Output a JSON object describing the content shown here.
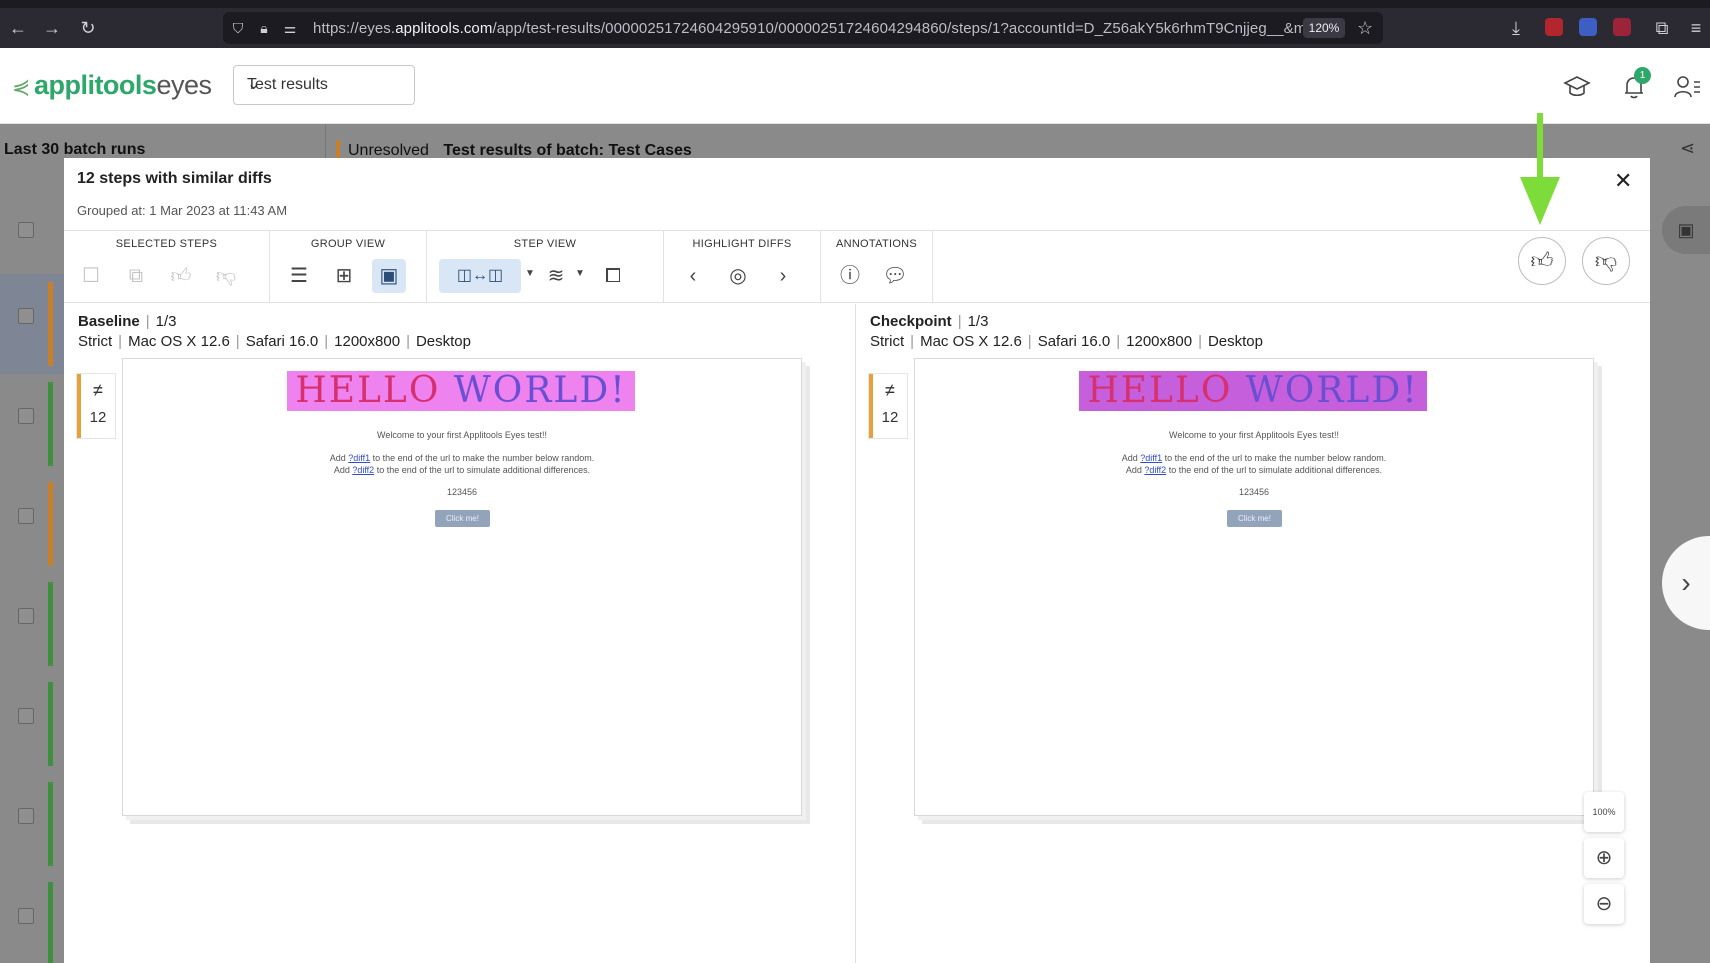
{
  "browser": {
    "url_prefix": "https://eyes.",
    "url_domain": "applitools.com",
    "url_rest": "/app/test-results/00000251724604295910/00000251724604294860/steps/1?accountId=D_Z56akY5k6rhmT9Cnjjeg__&mo",
    "zoom": "120%"
  },
  "header": {
    "logo_brand": "applitools",
    "logo_product": "eyes",
    "view_select": "Test results",
    "notification_count": "1"
  },
  "background": {
    "left_title": "Last 30 batch runs",
    "status": "Unresolved",
    "batch_title": "Test results of batch:  Test Cases",
    "row_stripe_colors": [
      "#c77f2a",
      "#3f8f3f",
      "#c77f2a",
      "#3f8f3f",
      "#3f8f3f",
      "#3f8f3f",
      "#3f8f3f"
    ]
  },
  "modal": {
    "title": "12 steps with similar diffs",
    "subtitle": "Grouped at: 1 Mar 2023 at 11:43 AM",
    "toolbar": {
      "selected_steps": "SELECTED STEPS",
      "group_view": "GROUP VIEW",
      "step_view": "STEP VIEW",
      "highlight_diffs": "HIGHLIGHT DIFFS",
      "annotations": "ANNOTATIONS"
    },
    "baseline": {
      "label": "Baseline",
      "index": "1/3",
      "match_level": "Strict",
      "os": "Mac OS X 12.6",
      "browser": "Safari 16.0",
      "viewport": "1200x800",
      "device": "Desktop",
      "diff_count": "12"
    },
    "checkpoint": {
      "label": "Checkpoint",
      "index": "1/3",
      "match_level": "Strict",
      "os": "Mac OS X 12.6",
      "browser": "Safari 16.0",
      "viewport": "1200x800",
      "device": "Desktop",
      "diff_count": "12"
    },
    "screenshot": {
      "hello_a": "HELLO",
      "hello_b": "WORLD!",
      "welcome": "Welcome to your first Applitools Eyes test!!",
      "line1_pre": "Add ",
      "line1_link": "?diff1",
      "line1_post": " to the end of the url to make the number below random.",
      "line2_pre": "Add ",
      "line2_link": "?diff2",
      "line2_post": " to the end of the url to simulate additional differences.",
      "number": "123456",
      "button": "Click me!"
    },
    "zoom_fit_label": "100%"
  },
  "colors": {
    "accent_green": "#7ddc3a",
    "brand_green": "#2ea86a",
    "warning_orange": "#e8a13a"
  }
}
